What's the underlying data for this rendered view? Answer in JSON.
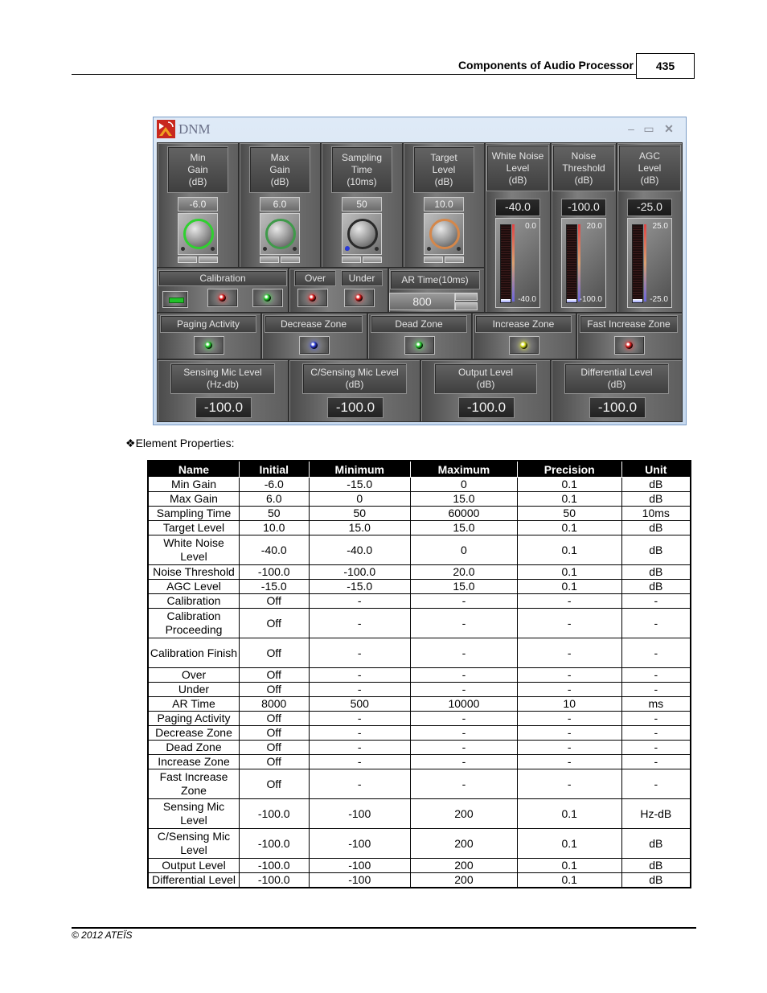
{
  "page_header": {
    "section_title": "Components of Audio Processor",
    "page_number": "435"
  },
  "footer": {
    "copyright": "© 2012 ATEÏS"
  },
  "window": {
    "title": "DNM",
    "controls": {
      "minimize": "–",
      "maximize": "▭",
      "close": "✕"
    },
    "knobs": [
      {
        "label_lines": [
          "Min",
          "Gain",
          "(dB)"
        ],
        "value": "-6.0",
        "ring_color": "#2fd12f"
      },
      {
        "label_lines": [
          "Max",
          "Gain",
          "(dB)"
        ],
        "value": "6.0",
        "ring_color": "#3f9a4a"
      },
      {
        "label_lines": [
          "Sampling",
          "Time",
          "(10ms)"
        ],
        "value": "50",
        "ring_color": "#2a2a2a"
      },
      {
        "label_lines": [
          "Target",
          "Level",
          "(dB)"
        ],
        "value": "10.0",
        "ring_color": "#d5874a"
      }
    ],
    "meters": [
      {
        "label_lines": [
          "White Noise",
          "Level",
          "(dB)"
        ],
        "value": "-40.0",
        "scale_max": "0.0",
        "scale_min": "-40.0",
        "fill_fraction": 0.0
      },
      {
        "label_lines": [
          "Noise",
          "Threshold",
          "(dB)"
        ],
        "value": "-100.0",
        "scale_max": "20.0",
        "scale_min": "-100.0",
        "fill_fraction": 0.0
      },
      {
        "label_lines": [
          "AGC",
          "Level",
          "(dB)"
        ],
        "value": "-25.0",
        "scale_max": "25.0",
        "scale_min": "-25.0",
        "fill_fraction": 0.0
      }
    ],
    "calibration": {
      "label": "Calibration",
      "leds": [
        "#e01a1a",
        "#22d12a"
      ],
      "bar_color": "#22c12a"
    },
    "over": {
      "label": "Over",
      "led": "#e01a1a"
    },
    "under": {
      "label": "Under",
      "led": "#e01a1a"
    },
    "ar_time": {
      "label": "AR Time(10ms)",
      "value": "800"
    },
    "zones": [
      {
        "label": "Paging Activity",
        "led": "#22d12a"
      },
      {
        "label": "Decrease Zone",
        "led": "#2a3ad9"
      },
      {
        "label": "Dead Zone",
        "led": "#22d12a"
      },
      {
        "label": "Increase Zone",
        "led": "#d8e01a"
      },
      {
        "label": "Fast Increase Zone",
        "led": "#e01a1a"
      }
    ],
    "levels": [
      {
        "label_lines": [
          "Sensing Mic Level",
          "(Hz-db)"
        ],
        "value": "-100.0"
      },
      {
        "label_lines": [
          "C/Sensing Mic Level",
          "(dB)"
        ],
        "value": "-100.0"
      },
      {
        "label_lines": [
          "Output Level",
          "(dB)"
        ],
        "value": "-100.0"
      },
      {
        "label_lines": [
          "Differential Level",
          "(dB)"
        ],
        "value": "-100.0"
      }
    ]
  },
  "element_properties": {
    "title": "Element Properties:",
    "bullet": "❖",
    "columns": [
      "Name",
      "Initial",
      "Minimum",
      "Maximum",
      "Precision",
      "Unit"
    ],
    "rows": [
      [
        "Min Gain",
        "-6.0",
        "-15.0",
        "0",
        "0.1",
        "dB"
      ],
      [
        "Max Gain",
        "6.0",
        "0",
        "15.0",
        "0.1",
        "dB"
      ],
      [
        "Sampling Time",
        "50",
        "50",
        "60000",
        "50",
        "10ms"
      ],
      [
        "Target Level",
        "10.0",
        "15.0",
        "15.0",
        "0.1",
        "dB"
      ],
      [
        "White Noise Level",
        "-40.0",
        "-40.0",
        "0",
        "0.1",
        "dB"
      ],
      [
        "Noise Threshold",
        "-100.0",
        "-100.0",
        "20.0",
        "0.1",
        "dB"
      ],
      [
        "AGC Level",
        "-15.0",
        "-15.0",
        "15.0",
        "0.1",
        "dB"
      ],
      [
        "Calibration",
        "Off",
        "-",
        "-",
        "-",
        "-"
      ],
      [
        "Calibration Proceeding",
        "Off",
        "-",
        "-",
        "-",
        "-"
      ],
      [
        "Calibration Finish",
        "Off",
        "-",
        "-",
        "-",
        "-"
      ],
      [
        "Over",
        "Off",
        "-",
        "-",
        "-",
        "-"
      ],
      [
        "Under",
        "Off",
        "-",
        "-",
        "-",
        "-"
      ],
      [
        "AR Time",
        "8000",
        "500",
        "10000",
        "10",
        "ms"
      ],
      [
        "Paging Activity",
        "Off",
        "-",
        "-",
        "-",
        "-"
      ],
      [
        "Decrease Zone",
        "Off",
        "-",
        "-",
        "-",
        "-"
      ],
      [
        "Dead Zone",
        "Off",
        "-",
        "-",
        "-",
        "-"
      ],
      [
        "Increase Zone",
        "Off",
        "-",
        "-",
        "-",
        "-"
      ],
      [
        "Fast Increase Zone",
        "Off",
        "-",
        "-",
        "-",
        "-"
      ],
      [
        "Sensing Mic Level",
        "-100.0",
        "-100",
        "200",
        "0.1",
        "Hz-dB"
      ],
      [
        "C/Sensing Mic Level",
        "-100.0",
        "-100",
        "200",
        "0.1",
        "dB"
      ],
      [
        "Output Level",
        "-100.0",
        "-100",
        "200",
        "0.1",
        "dB"
      ],
      [
        "Differential Level",
        "-100.0",
        "-100",
        "200",
        "0.1",
        "dB"
      ]
    ]
  }
}
